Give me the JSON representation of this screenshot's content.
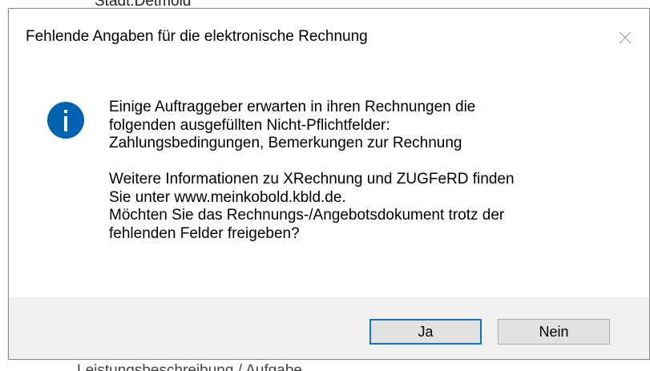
{
  "background": {
    "top_text": "Stadt:Detmold",
    "bottom_text": "Leistungsbeschreibung / Aufgabe"
  },
  "dialog": {
    "title": "Fehlende Angaben für die elektronische Rechnung",
    "close_icon": "close-icon",
    "icon": "info-icon",
    "message_paragraph1": [
      "Einige Auftraggeber erwarten in ihren Rechnungen die",
      "folgenden ausgefüllten Nicht-Pflichtfelder:",
      "Zahlungsbedingungen, Bemerkungen zur Rechnung"
    ],
    "message_paragraph2": [
      "Weitere Informationen zu XRechnung und ZUGFeRD finden",
      "Sie unter www.meinkobold.kbld.de.",
      "Möchten Sie das Rechnungs-/Angebotsdokument trotz der",
      "fehlenden Felder freigeben?"
    ],
    "buttons": {
      "yes_label": "Ja",
      "no_label": "Nein"
    },
    "colors": {
      "icon_blue": "#0063b1",
      "focus_border": "#0078d7",
      "footer_bg": "#f0f0f0"
    }
  }
}
